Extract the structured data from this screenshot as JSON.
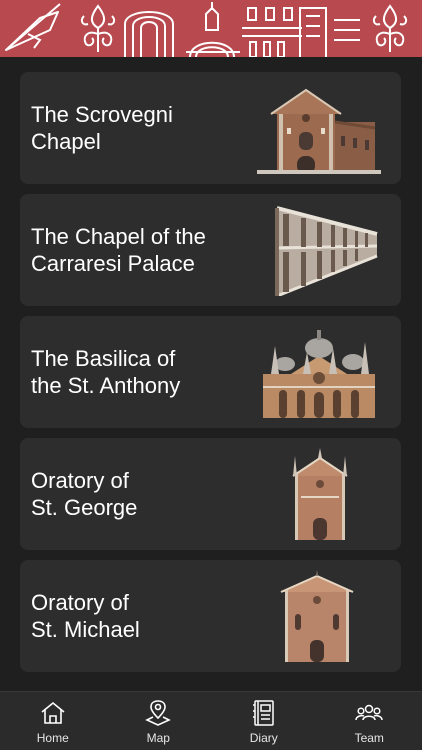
{
  "header": {
    "banner_color": "#b8494f",
    "motifs": [
      "quill-icon",
      "lily-ornament",
      "arch-icon",
      "dome-icon",
      "facade-icon",
      "lily-ornament"
    ]
  },
  "sites": [
    {
      "title": "The Scrovegni\nChapel",
      "image": "scrovegni-chapel-photo"
    },
    {
      "title": "The Chapel of the\nCarraresi Palace",
      "image": "carraresi-loggia-photo"
    },
    {
      "title": "The Basilica of\nthe St. Anthony",
      "image": "basilica-st-anthony-photo"
    },
    {
      "title": "Oratory of\nSt. George",
      "image": "oratory-st-george-photo"
    },
    {
      "title": "Oratory of\nSt. Michael",
      "image": "oratory-st-michael-photo"
    }
  ],
  "tabbar": {
    "items": [
      {
        "label": "Home",
        "icon": "home-icon"
      },
      {
        "label": "Map",
        "icon": "map-pin-icon"
      },
      {
        "label": "Diary",
        "icon": "diary-icon"
      },
      {
        "label": "Team",
        "icon": "team-icon"
      }
    ]
  }
}
